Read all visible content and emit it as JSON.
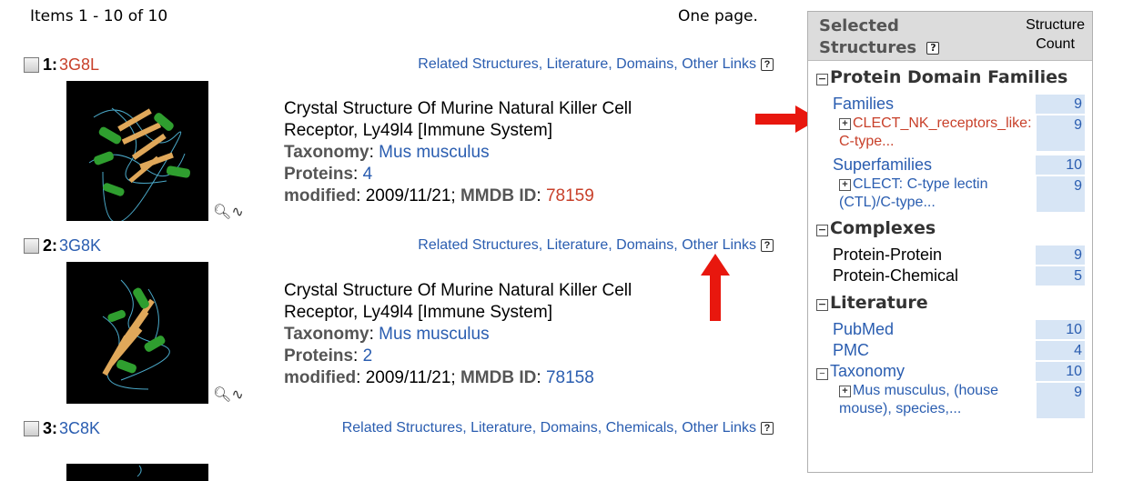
{
  "pager": {
    "items": "Items 1 - 10 of 10",
    "pages": "One page."
  },
  "results": [
    {
      "num": "1:",
      "accession": "3G8L",
      "accession_red": true,
      "links": [
        "Related Structures",
        "Literature",
        "Domains",
        "Other Links"
      ],
      "title_line1": "Crystal Structure Of Murine Natural Killer Cell",
      "title_line2": "Receptor, Ly49l4 [Immune System]",
      "taxonomy_label": "Taxonomy",
      "taxonomy": "Mus musculus",
      "proteins_label": "Proteins",
      "proteins": "4",
      "modified_label": "modified",
      "modified": "2009/11/21;",
      "mmdb_label": "MMDB ID",
      "mmdb": "78159"
    },
    {
      "num": "2:",
      "accession": "3G8K",
      "accession_red": false,
      "links": [
        "Related Structures",
        "Literature",
        "Domains",
        "Other Links"
      ],
      "title_line1": "Crystal Structure Of Murine Natural Killer Cell",
      "title_line2": "Receptor, Ly49l4 [Immune System]",
      "taxonomy_label": "Taxonomy",
      "taxonomy": "Mus musculus",
      "proteins_label": "Proteins",
      "proteins": "2",
      "modified_label": "modified",
      "modified": "2009/11/21;",
      "mmdb_label": "MMDB ID",
      "mmdb": "78158"
    },
    {
      "num": "3:",
      "accession": "3C8K",
      "accession_red": false,
      "links": [
        "Related Structures",
        "Literature",
        "Domains",
        "Chemicals",
        "Other Links"
      ]
    }
  ],
  "panel": {
    "title_line1": "Selected",
    "title_line2": "Structures",
    "count_line1": "Structure",
    "count_line2": "Count",
    "help": "?",
    "sections": {
      "domains": {
        "title": "Protein Domain Families",
        "families_label": "Families",
        "families_count": "9",
        "families_sub": "CLECT_NK_receptors_like: C-type...",
        "families_sub_count": "9",
        "superfamilies_label": "Superfamilies",
        "superfamilies_count": "10",
        "superfamilies_sub": "CLECT: C-type lectin (CTL)/C-type...",
        "superfamilies_sub_count": "9"
      },
      "complexes": {
        "title": "Complexes",
        "pp_label": "Protein-Protein",
        "pp_count": "9",
        "pc_label": "Protein-Chemical",
        "pc_count": "5"
      },
      "literature": {
        "title": "Literature",
        "pubmed_label": "PubMed",
        "pubmed_count": "10",
        "pmc_label": "PMC",
        "pmc_count": "4"
      },
      "taxonomy": {
        "title": "Taxonomy",
        "count": "10",
        "sub": "Mus musculus, (house mouse), species,...",
        "sub_count": "9"
      }
    }
  },
  "colors": {
    "link": "#2a5db0",
    "accent_red": "#c8402a",
    "arrow": "#e8170e"
  }
}
